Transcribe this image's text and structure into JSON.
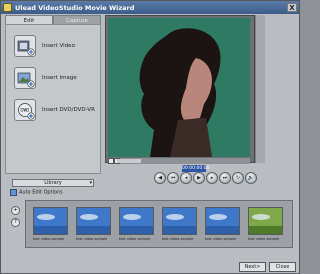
{
  "window": {
    "title": "Ulead VideoStudio Movie Wizard",
    "close_label": "X"
  },
  "tabs": [
    {
      "label": "Edit"
    },
    {
      "label": "Capture"
    }
  ],
  "actions": [
    {
      "label": "Insert Video",
      "icon": "film-strip-plus-icon"
    },
    {
      "label": "Insert Image",
      "icon": "image-plus-icon"
    },
    {
      "label": "Insert DVD/DVD-VR",
      "icon": "dvd-plus-icon"
    }
  ],
  "player": {
    "timecode": "00:00:00:00",
    "progress": 0.18,
    "controls": [
      {
        "name": "rewind",
        "glyph": "◀"
      },
      {
        "name": "start",
        "glyph": "⏮"
      },
      {
        "name": "prev",
        "glyph": "◂"
      },
      {
        "name": "play",
        "glyph": "▶"
      },
      {
        "name": "next",
        "glyph": "▸"
      },
      {
        "name": "end",
        "glyph": "⏭"
      },
      {
        "name": "repeat",
        "glyph": "↻"
      },
      {
        "name": "volume",
        "glyph": "🔈"
      }
    ]
  },
  "library": {
    "dropdown_value": "Library",
    "auto_edit_label": "Auto Edit Options",
    "tool_buttons": [
      "+",
      "?"
    ],
    "thumbnails": [
      {
        "label": "test video sample",
        "scene": "blue"
      },
      {
        "label": "test video sample",
        "scene": "blue"
      },
      {
        "label": "test video sample",
        "scene": "blue"
      },
      {
        "label": "test video sample",
        "scene": "blue"
      },
      {
        "label": "test video sample",
        "scene": "blue"
      },
      {
        "label": "test video sample",
        "scene": "green"
      }
    ]
  },
  "footer": {
    "next_label": "Next>",
    "close_label": "Close"
  },
  "colors": {
    "video_bg": "#2e7a63",
    "title_bar": "#3d5c89",
    "timecode_bg": "#2c56a4"
  }
}
